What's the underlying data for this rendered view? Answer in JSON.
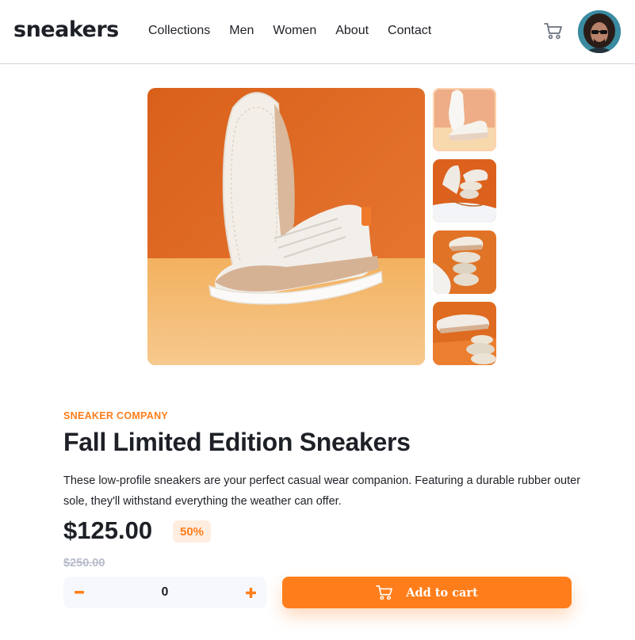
{
  "header": {
    "logo": "sneakers",
    "nav": [
      "Collections",
      "Men",
      "Women",
      "About",
      "Contact"
    ]
  },
  "icons": {
    "cart": "cart-icon",
    "avatar": "avatar",
    "minus": "minus-icon",
    "plus": "plus-icon"
  },
  "product": {
    "company": "SNEAKER COMPANY",
    "title": "Fall Limited Edition Sneakers",
    "description": "These low-profile sneakers are your perfect casual wear companion. Featuring a durable rubber outer sole, they'll withstand everything the weather can offer.",
    "price": "$125.00",
    "discount": "50%",
    "old_price": "$250.00"
  },
  "cart_controls": {
    "minus_label": "−",
    "quantity": "0",
    "plus_label": "+",
    "add_label": "Add to cart"
  },
  "gallery": {
    "thumbnails": 4,
    "active_index": 0
  },
  "colors": {
    "accent": "#ff7e1b",
    "accent_pale": "#ffede0",
    "dark": "#1d2026",
    "muted": "#b6bcc8"
  }
}
